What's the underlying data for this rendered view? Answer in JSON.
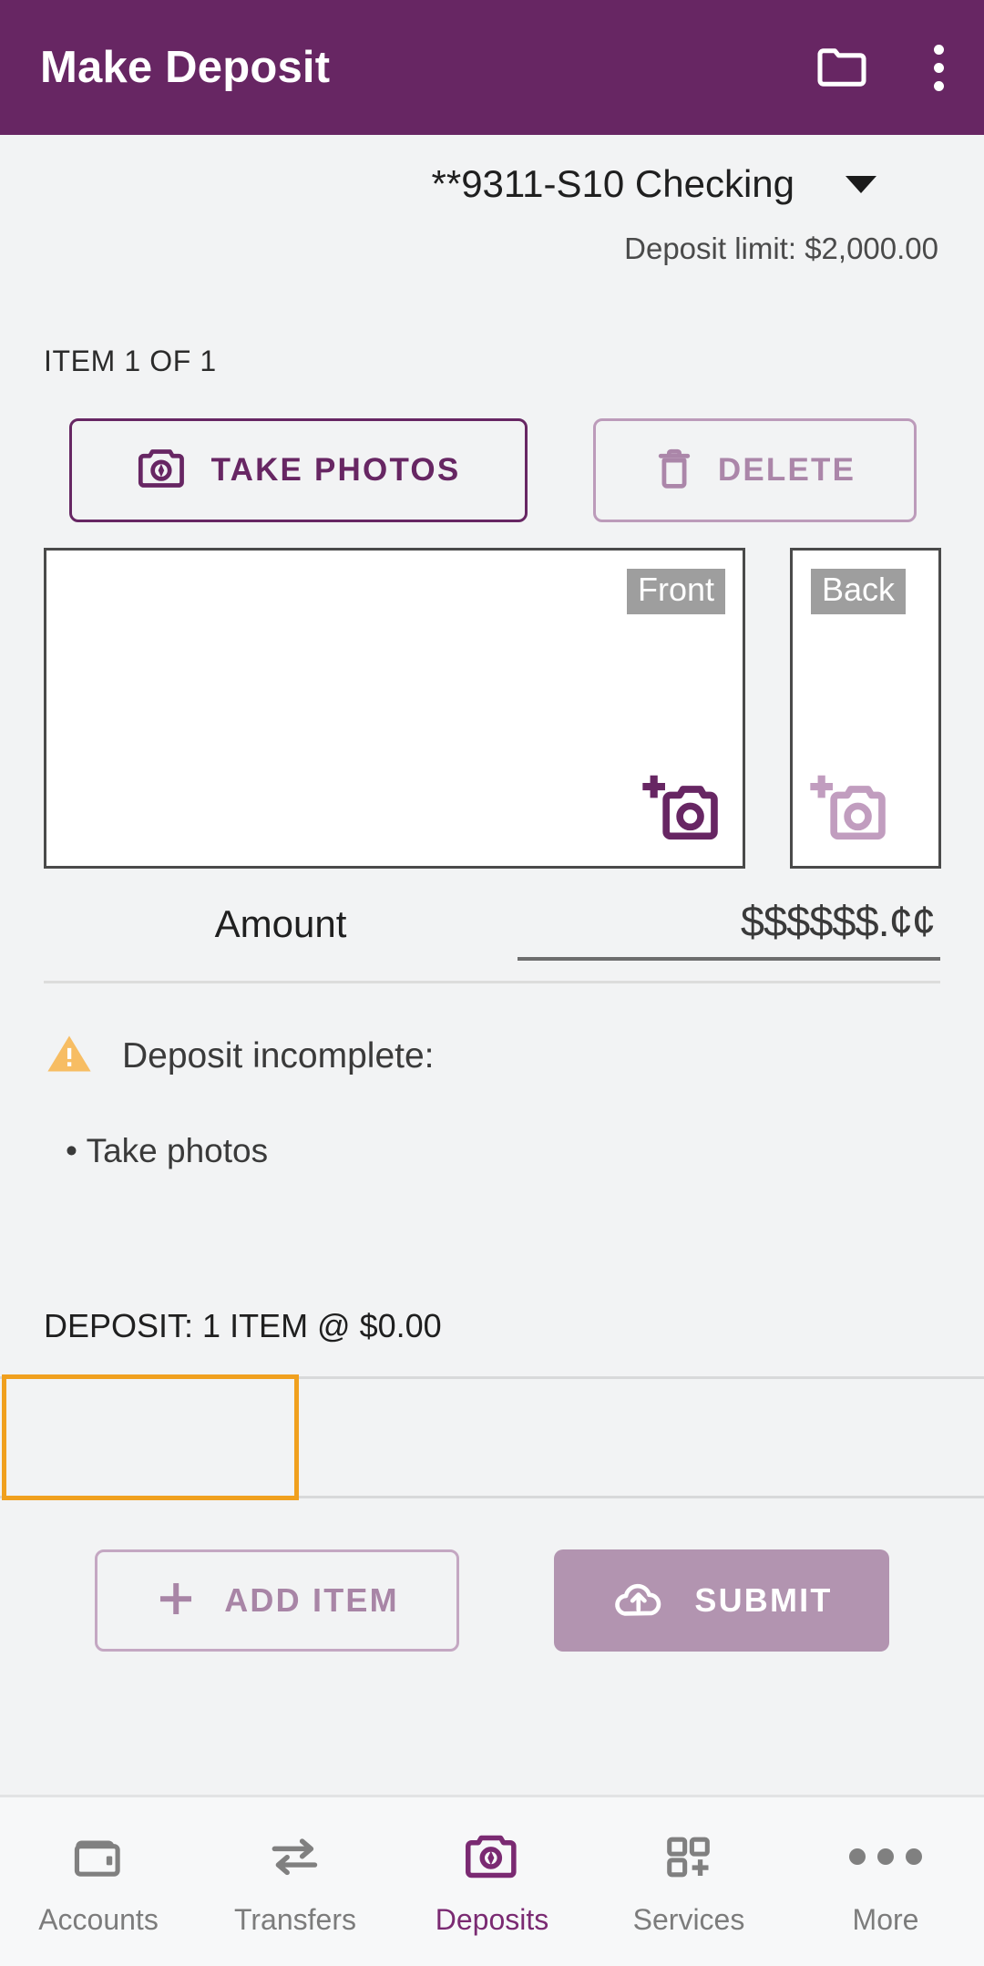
{
  "appbar": {
    "title": "Make Deposit",
    "folder_icon": "folder-icon",
    "overflow_icon": "overflow-menu-icon"
  },
  "account": {
    "name": "**9311-S10 Checking",
    "caret_icon": "chevron-down-icon",
    "deposit_limit": "Deposit limit: $2,000.00"
  },
  "item": {
    "counter": "ITEM 1 OF 1",
    "take_photos_label": "TAKE PHOTOS",
    "take_photos_icon": "camera-icon",
    "delete_label": "DELETE",
    "delete_icon": "trash-icon"
  },
  "photos": {
    "front_tag": "Front",
    "back_tag": "Back",
    "add_photo_icon": "add-a-photo-icon"
  },
  "amount": {
    "label": "Amount",
    "placeholder": "$$$$$$.¢¢"
  },
  "warning": {
    "icon": "warning-triangle-icon",
    "title": "Deposit incomplete:",
    "items": [
      "• Take photos"
    ]
  },
  "summary": {
    "text": "DEPOSIT: 1 ITEM @ $0.00"
  },
  "actions": {
    "add_item_label": "ADD ITEM",
    "add_item_icon": "plus-icon",
    "submit_label": "SUBMIT",
    "submit_icon": "cloud-upload-icon"
  },
  "bottomnav": {
    "items": [
      {
        "label": "Accounts",
        "icon": "wallet-icon",
        "active": false
      },
      {
        "label": "Transfers",
        "icon": "transfer-arrows-icon",
        "active": false
      },
      {
        "label": "Deposits",
        "icon": "camera-icon",
        "active": true
      },
      {
        "label": "Services",
        "icon": "grid-plus-icon",
        "active": false
      },
      {
        "label": "More",
        "icon": "more-dots-icon",
        "active": false
      }
    ]
  },
  "colors": {
    "brand_purple": "#672663",
    "muted_purple": "#b294b0",
    "warning_orange": "#f5b553",
    "focus_orange": "#f0a01e",
    "page_bg": "#f2f3f4"
  }
}
